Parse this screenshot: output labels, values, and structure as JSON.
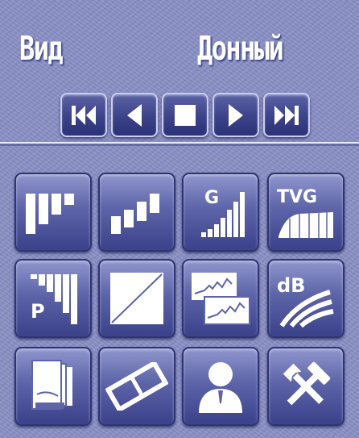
{
  "header": {
    "view_label": "Вид",
    "view_value": "Донный"
  },
  "transport": {
    "buttons": [
      {
        "name": "rewind-button",
        "icon": "skip-back-icon"
      },
      {
        "name": "previous-button",
        "icon": "play-reverse-icon"
      },
      {
        "name": "stop-button",
        "icon": "stop-icon"
      },
      {
        "name": "play-button",
        "icon": "play-icon"
      },
      {
        "name": "forward-button",
        "icon": "skip-forward-icon"
      }
    ]
  },
  "grid": {
    "buttons": [
      {
        "name": "histogram-button",
        "icon": "histogram-icon",
        "text": ""
      },
      {
        "name": "rising-bars-button",
        "icon": "rising-bars-icon",
        "text": ""
      },
      {
        "name": "gain-button",
        "icon": "gain-bars-icon",
        "text": "G"
      },
      {
        "name": "tvg-button",
        "icon": "tvg-curve-icon",
        "text": "TVG"
      },
      {
        "name": "power-button",
        "icon": "power-bars-icon",
        "text": "P"
      },
      {
        "name": "diagonal-button",
        "icon": "diagonal-line-icon",
        "text": ""
      },
      {
        "name": "waveform-button",
        "icon": "stacked-waveforms-icon",
        "text": ""
      },
      {
        "name": "decibel-button",
        "icon": "decibel-waves-icon",
        "text": "dB"
      },
      {
        "name": "pages-button",
        "icon": "stacked-pages-icon",
        "text": ""
      },
      {
        "name": "tilted-frame-button",
        "icon": "tilted-frame-icon",
        "text": ""
      },
      {
        "name": "user-button",
        "icon": "user-icon",
        "text": ""
      },
      {
        "name": "tools-button",
        "icon": "tools-icon",
        "text": ""
      }
    ]
  },
  "colors": {
    "panel": "#8990c6",
    "button_dark": "#2c3276",
    "icon": "#ffffff"
  }
}
